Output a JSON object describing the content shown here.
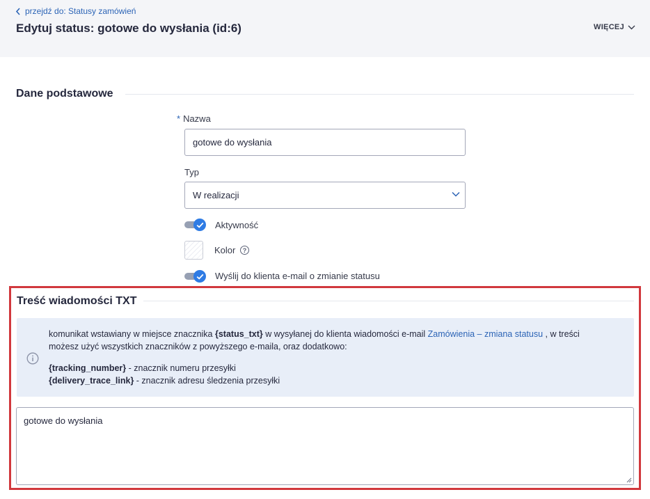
{
  "header": {
    "back_link": "przejdź do: Statusy zamówień",
    "title": "Edytuj status: gotowe do wysłania (id:6)",
    "more_label": "WIĘCEJ"
  },
  "basic_section": {
    "title": "Dane podstawowe",
    "name_required_mark": "*",
    "name_label": "Nazwa",
    "name_value": "gotowe do wysłania",
    "type_label": "Typ",
    "type_value": "W realizacji",
    "active_label": "Aktywność",
    "active_on": true,
    "color_label": "Kolor",
    "color_help": "?",
    "send_email_label": "Wyślij do klienta e-mail o zmianie statusu",
    "send_email_on": true
  },
  "txt_section": {
    "title": "Treść wiadomości TXT",
    "info": {
      "p1_a": "komunikat wstawiany w miejsce znacznika ",
      "p1_tag": "{status_txt}",
      "p1_b": " w wysyłanej do klienta wiadomości e-mail ",
      "p1_link": "Zamówienia – zmiana statusu",
      "p1_c": " , w treści",
      "p2": "możesz użyć wszystkich znaczników z powyższego e-maila, oraz dodatkowo:",
      "tag1": "{tracking_number}",
      "tag1_desc": " - znacznik numeru przesyłki",
      "tag2": "{delivery_trace_link}",
      "tag2_desc": " - znacznik adresu śledzenia przesyłki"
    },
    "message_value": "gotowe do wysłania"
  },
  "colors": {
    "accent": "#2c64b6",
    "toggle_on": "#2e7be4",
    "highlight_border": "#d1383d",
    "info_bg": "#e8eef8",
    "header_bg": "#f4f5f8"
  },
  "icons": {
    "back": "chevron-left-icon",
    "more": "chevron-down-icon",
    "select": "chevron-down-icon",
    "toggle": "check-icon",
    "help": "question-circle-icon",
    "info": "info-circle-icon",
    "resize": "resize-grip-icon"
  }
}
